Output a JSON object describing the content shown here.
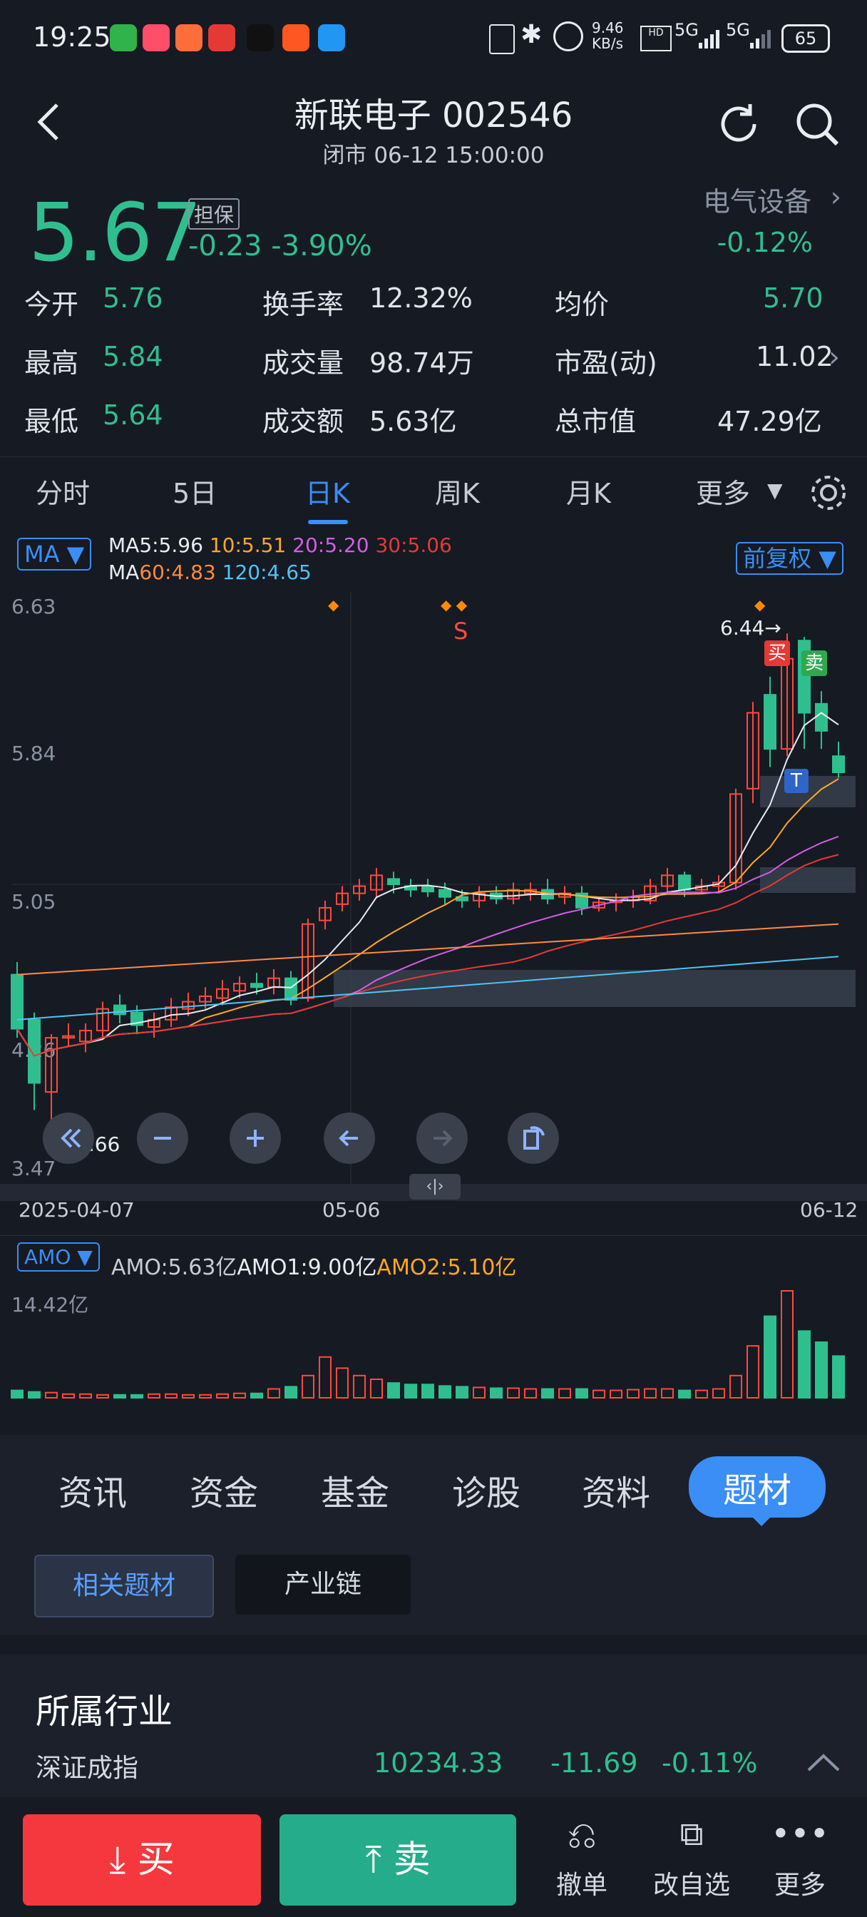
{
  "status": {
    "time": "19:25",
    "net_speed": "9.46 KB/s",
    "net_label1": "5G",
    "net_label2": "5G",
    "battery": "65"
  },
  "header": {
    "title": "新联电子 002546",
    "subtitle": "闭市 06-12 15:00:00"
  },
  "quote": {
    "price": "5.67",
    "tag": "担保",
    "change": "-0.23 -3.90%",
    "industry": "电气设备",
    "industry_pct": "-0.12%"
  },
  "stats": [
    {
      "label": "今开",
      "value": "5.76"
    },
    {
      "label": "换手率",
      "value": "12.32%"
    },
    {
      "label": "均价",
      "value": "5.70"
    },
    {
      "label": "最高",
      "value": "5.84"
    },
    {
      "label": "成交量",
      "value": "98.74万"
    },
    {
      "label": "市盈(动)",
      "value": "11.02"
    },
    {
      "label": "最低",
      "value": "5.64"
    },
    {
      "label": "成交额",
      "value": "5.63亿"
    },
    {
      "label": "总市值",
      "value": "47.29亿"
    }
  ],
  "tabs": [
    "分时",
    "5日",
    "日K",
    "周K",
    "月K",
    "更多"
  ],
  "chart": {
    "ma_button": "MA",
    "ma_line1": [
      {
        "text": "MA5:5.96",
        "color": "#e9edf2"
      },
      {
        "text": "10:5.51",
        "color": "#ffa726"
      },
      {
        "text": "20:5.20",
        "color": "#d45de6"
      },
      {
        "text": "30:5.06",
        "color": "#e53935"
      }
    ],
    "ma_line2": [
      {
        "text": "MA",
        "color": "#e9edf2"
      },
      {
        "text": "60:4.83",
        "color": "#ff8a3d"
      },
      {
        "text": "120:4.65",
        "color": "#4fc3f7"
      }
    ],
    "adjust": "前复权",
    "y_labels": [
      "6.63",
      "5.84",
      "5.05",
      "4.26",
      "3.47"
    ],
    "x_labels": [
      "2025-04-07",
      "05-06",
      "06-12"
    ],
    "high_marker": "6.44→",
    "low_marker": "3.66",
    "buy_tag": "买",
    "sell_tag": "卖",
    "t_tag": "T",
    "s_tag": "S",
    "amo_button": "AMO",
    "amo_legend": [
      {
        "text": "AMO:5.63亿",
        "color": "#c7ccd6"
      },
      {
        "text": "AMO1:9.00亿",
        "color": "#e9edf2"
      },
      {
        "text": "AMO2:5.10亿",
        "color": "#ffa726"
      }
    ],
    "amo_max": "14.42亿"
  },
  "chart_data": {
    "type": "candlestick",
    "x_start": "2025-04-07",
    "x_end": "06-12",
    "ylim": [
      3.47,
      6.63
    ],
    "candles": [
      [
        4.55,
        4.25,
        4.62,
        4.2
      ],
      [
        4.3,
        3.95,
        4.34,
        3.8
      ],
      [
        3.9,
        4.2,
        4.22,
        3.66
      ],
      [
        4.2,
        4.21,
        4.28,
        4.15
      ],
      [
        4.18,
        4.24,
        4.28,
        4.12
      ],
      [
        4.24,
        4.36,
        4.4,
        4.2
      ],
      [
        4.38,
        4.33,
        4.44,
        4.28
      ],
      [
        4.34,
        4.27,
        4.38,
        4.22
      ],
      [
        4.26,
        4.3,
        4.34,
        4.2
      ],
      [
        4.3,
        4.37,
        4.42,
        4.26
      ],
      [
        4.36,
        4.4,
        4.45,
        4.32
      ],
      [
        4.4,
        4.43,
        4.48,
        4.36
      ],
      [
        4.42,
        4.47,
        4.52,
        4.38
      ],
      [
        4.46,
        4.5,
        4.54,
        4.42
      ],
      [
        4.5,
        4.48,
        4.56,
        4.44
      ],
      [
        4.48,
        4.53,
        4.58,
        4.44
      ],
      [
        4.53,
        4.41,
        4.57,
        4.38
      ],
      [
        4.42,
        4.83,
        4.86,
        4.4
      ],
      [
        4.85,
        4.92,
        4.96,
        4.8
      ],
      [
        4.94,
        5.0,
        5.04,
        4.9
      ],
      [
        5.0,
        5.04,
        5.08,
        4.96
      ],
      [
        5.02,
        5.1,
        5.14,
        4.98
      ],
      [
        5.08,
        5.05,
        5.12,
        5.0
      ],
      [
        5.04,
        5.02,
        5.08,
        4.98
      ],
      [
        5.04,
        5.01,
        5.08,
        4.98
      ],
      [
        5.02,
        4.98,
        5.06,
        4.94
      ],
      [
        4.98,
        4.96,
        5.02,
        4.92
      ],
      [
        4.96,
        5.0,
        5.04,
        4.92
      ],
      [
        5.0,
        4.97,
        5.04,
        4.94
      ],
      [
        4.97,
        5.02,
        5.06,
        4.94
      ],
      [
        5.0,
        5.02,
        5.06,
        4.96
      ],
      [
        5.02,
        4.97,
        5.08,
        4.94
      ],
      [
        4.98,
        5.0,
        5.04,
        4.94
      ],
      [
        5.0,
        4.92,
        5.04,
        4.88
      ],
      [
        4.92,
        4.95,
        4.98,
        4.9
      ],
      [
        4.95,
        4.96,
        5.0,
        4.9
      ],
      [
        4.96,
        4.98,
        5.02,
        4.92
      ],
      [
        4.96,
        5.04,
        5.08,
        4.94
      ],
      [
        5.04,
        5.1,
        5.14,
        5.0
      ],
      [
        5.1,
        5.02,
        5.12,
        4.98
      ],
      [
        5.02,
        5.04,
        5.08,
        5.0
      ],
      [
        5.04,
        5.06,
        5.1,
        5.0
      ],
      [
        5.06,
        5.55,
        5.58,
        5.02
      ],
      [
        5.58,
        6.0,
        6.06,
        5.5
      ],
      [
        6.1,
        5.8,
        6.2,
        5.7
      ],
      [
        5.8,
        6.3,
        6.44,
        5.76
      ],
      [
        6.4,
        6.0,
        6.42,
        5.8
      ],
      [
        6.05,
        5.9,
        6.12,
        5.8
      ],
      [
        5.76,
        5.67,
        5.84,
        5.64
      ]
    ],
    "amo": [
      1.0,
      0.8,
      0.7,
      0.5,
      0.5,
      0.4,
      0.4,
      0.4,
      0.5,
      0.5,
      0.4,
      0.4,
      0.5,
      0.6,
      0.6,
      1.2,
      1.5,
      3.0,
      5.5,
      4.0,
      3.0,
      2.5,
      2.0,
      1.8,
      1.8,
      1.6,
      1.5,
      1.4,
      1.3,
      1.3,
      1.2,
      1.2,
      1.2,
      1.2,
      1.0,
      1.0,
      1.1,
      1.2,
      1.2,
      1.0,
      1.0,
      1.2,
      3.0,
      7.0,
      11.0,
      14.42,
      9.0,
      7.5,
      5.63
    ],
    "amo_ylim": [
      0,
      14.42
    ]
  },
  "info_tabs": [
    "资讯",
    "资金",
    "基金",
    "诊股",
    "资料",
    "题材"
  ],
  "sub_tabs": [
    "相关题材",
    "产业链"
  ],
  "industry_section": {
    "title": "所属行业",
    "index_name": "深证成指",
    "index_value": "10234.33",
    "index_change": "-11.69",
    "index_pct": "-0.11%"
  },
  "bottom": {
    "buy": "买",
    "sell": "卖",
    "cancel": "撤单",
    "edit_watch": "改自选",
    "more": "更多"
  }
}
